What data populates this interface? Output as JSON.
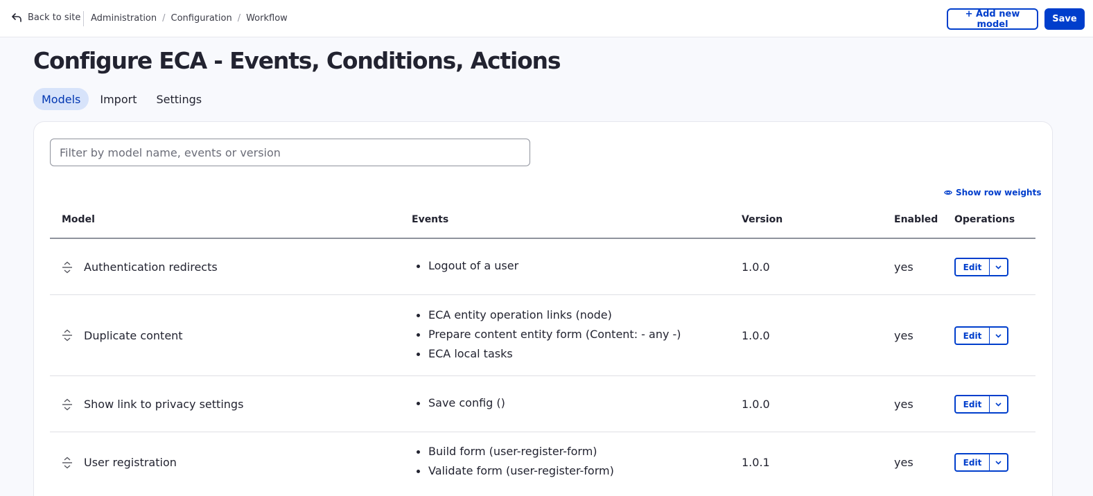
{
  "toolbar": {
    "back_label": "Back to site",
    "breadcrumbs": [
      "Administration",
      "Configuration",
      "Workflow"
    ],
    "add_label": "+ Add new model",
    "save_label": "Save"
  },
  "page": {
    "title": "Configure ECA - Events, Conditions, Actions",
    "tabs": [
      {
        "label": "Models",
        "active": true
      },
      {
        "label": "Import",
        "active": false
      },
      {
        "label": "Settings",
        "active": false
      }
    ]
  },
  "filter": {
    "placeholder": "Filter by model name, events or version"
  },
  "row_weights_label": "Show row weights",
  "table": {
    "headers": {
      "model": "Model",
      "events": "Events",
      "version": "Version",
      "enabled": "Enabled",
      "operations": "Operations"
    },
    "rows": [
      {
        "model": "Authentication redirects",
        "events": [
          "Logout of a user"
        ],
        "version": "1.0.0",
        "enabled": "yes",
        "edit": "Edit"
      },
      {
        "model": "Duplicate content",
        "events": [
          "ECA entity operation links (node)",
          "Prepare content entity form (Content: - any -)",
          "ECA local tasks"
        ],
        "version": "1.0.0",
        "enabled": "yes",
        "edit": "Edit"
      },
      {
        "model": "Show link to privacy settings",
        "events": [
          "Save config ()"
        ],
        "version": "1.0.0",
        "enabled": "yes",
        "edit": "Edit"
      },
      {
        "model": "User registration",
        "events": [
          "Build form (user-register-form)",
          "Validate form (user-register-form)"
        ],
        "version": "1.0.1",
        "enabled": "yes",
        "edit": "Edit"
      }
    ]
  },
  "colors": {
    "accent": "#003ecc",
    "tab_active_bg": "#d7e3fa",
    "page_bg": "#f8f9fd"
  },
  "icons": {
    "back": "back-arrow-icon",
    "drag": "drag-handle-icon",
    "eye": "eye-icon",
    "dropdown": "chevron-down-icon"
  }
}
